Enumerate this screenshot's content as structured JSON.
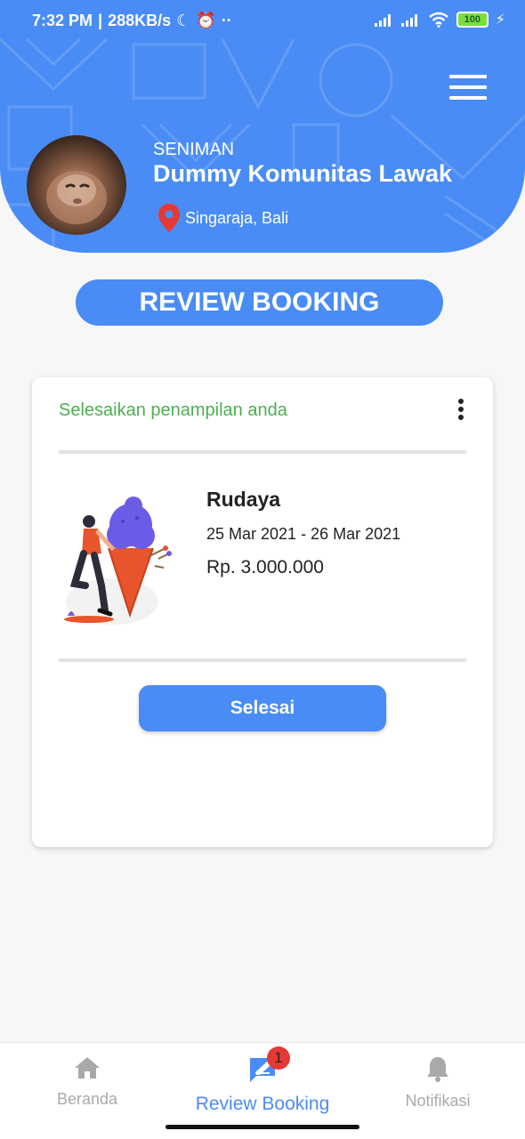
{
  "status_bar": {
    "time": "7:32 PM",
    "speed": "288KB/s",
    "battery": "100"
  },
  "profile": {
    "role": "SENIMAN",
    "name": "Dummy Komunitas Lawak",
    "location": "Singaraja, Bali"
  },
  "page_title": "REVIEW BOOKING",
  "card": {
    "heading": "Selesaikan penampilan anda",
    "booking": {
      "name": "Rudaya",
      "date_range": "25 Mar 2021 - 26 Mar 2021",
      "price": "Rp. 3.000.000"
    },
    "action_label": "Selesai"
  },
  "bottom_nav": {
    "items": [
      {
        "label": "Beranda",
        "icon": "home-icon"
      },
      {
        "label": "Review Booking",
        "icon": "review-icon",
        "badge": "1"
      },
      {
        "label": "Notifikasi",
        "icon": "bell-icon"
      }
    ]
  },
  "colors": {
    "primary": "#4a8cf5",
    "success_text": "#4caf50",
    "badge": "#e53935"
  }
}
